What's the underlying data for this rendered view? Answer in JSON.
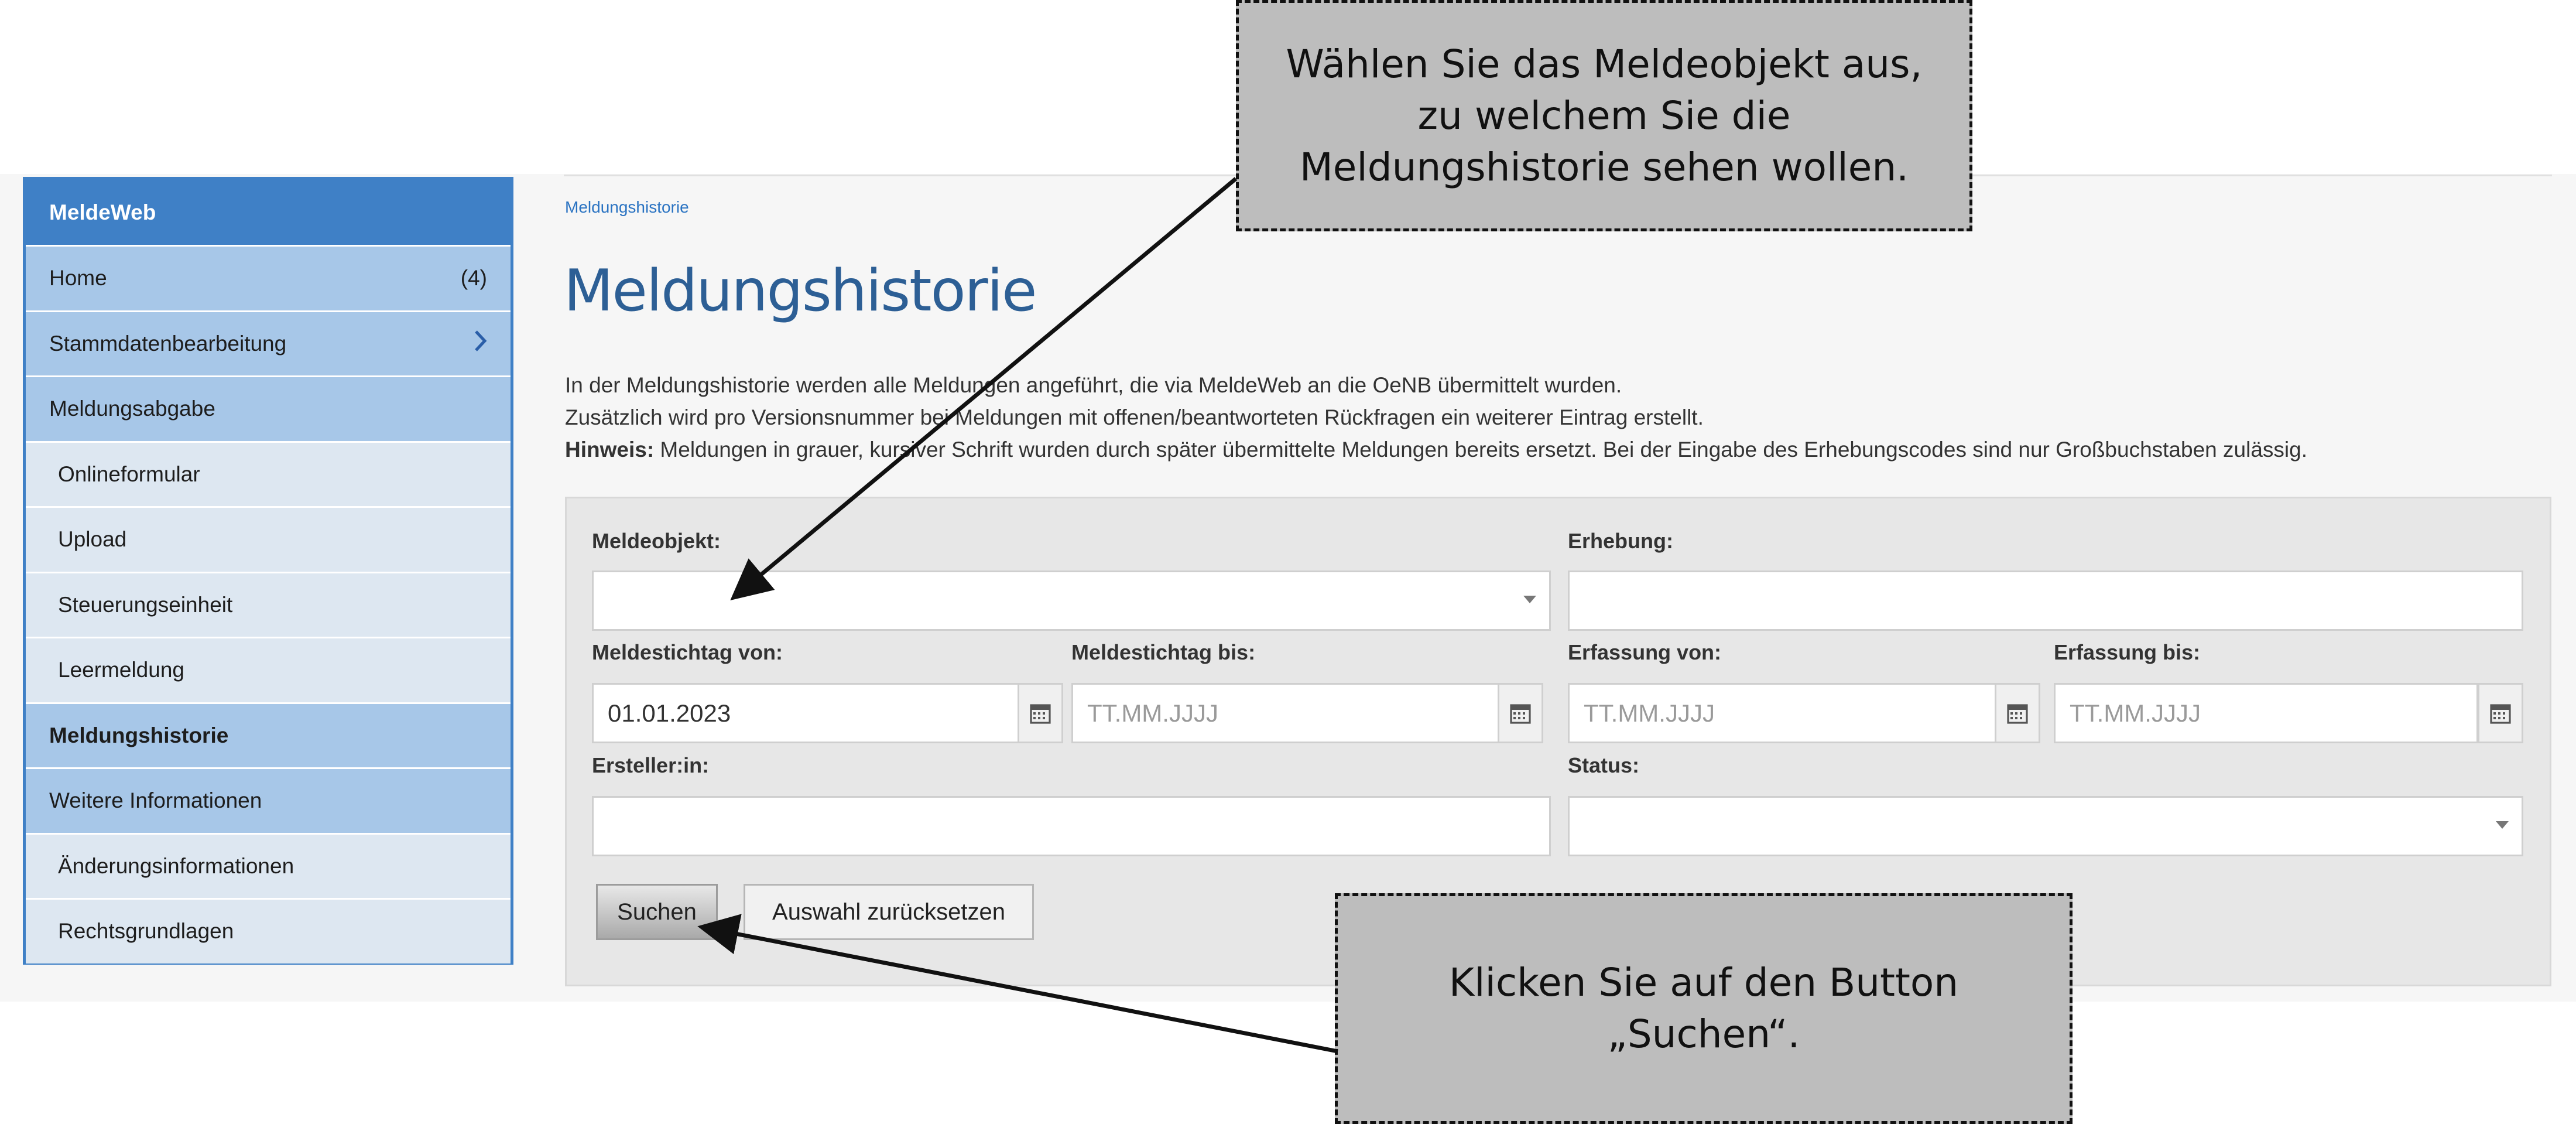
{
  "sidebar": {
    "header": "MeldeWeb",
    "items": [
      {
        "label": "Home",
        "count": "(4)"
      },
      {
        "label": "Stammdatenbearbeitung"
      },
      {
        "label": "Meldungsabgabe"
      },
      {
        "label": "Onlineformular"
      },
      {
        "label": "Upload"
      },
      {
        "label": "Steuerungseinheit"
      },
      {
        "label": "Leermeldung"
      },
      {
        "label": "Meldungshistorie"
      },
      {
        "label": "Weitere Informationen"
      },
      {
        "label": "Änderungsinformationen"
      },
      {
        "label": "Rechtsgrundlagen"
      }
    ]
  },
  "breadcrumb": "Meldungshistorie",
  "page_title": "Meldungshistorie",
  "description": {
    "line1": "In der Meldungshistorie werden alle Meldungen angeführt, die via MeldeWeb an die OeNB übermittelt wurden.",
    "line2": "Zusätzlich wird pro Versionsnummer bei Meldungen mit offenen/beantworteten Rückfragen ein weiterer Eintrag erstellt.",
    "hint_label": "Hinweis:",
    "hint_text": " Meldungen in grauer, kursiver Schrift wurden durch später übermittelte Meldungen bereits ersetzt. Bei der Eingabe des Erhebungscodes sind nur Großbuchstaben zulässig."
  },
  "form": {
    "meldeobjekt_label": "Meldeobjekt:",
    "meldeobjekt_value": "",
    "erhebung_label": "Erhebung:",
    "erhebung_value": "",
    "stichtag_von_label": "Meldestichtag von:",
    "stichtag_von_value": "01.01.2023",
    "stichtag_bis_label": "Meldestichtag bis:",
    "stichtag_bis_placeholder": "TT.MM.JJJJ",
    "erfassung_von_label": "Erfassung von:",
    "erfassung_von_placeholder": "TT.MM.JJJJ",
    "erfassung_bis_label": "Erfassung bis:",
    "erfassung_bis_placeholder": "TT.MM.JJJJ",
    "ersteller_label": "Ersteller:in:",
    "ersteller_value": "",
    "status_label": "Status:",
    "status_value": "",
    "search_button": "Suchen",
    "reset_button": "Auswahl zurücksetzen"
  },
  "callouts": {
    "top": "Wählen Sie das Meldeobjekt aus, zu welchem Sie die Meldungshistorie sehen wollen.",
    "bottom": "Klicken Sie auf den Button „Suchen“."
  },
  "colors": {
    "sidebar_header": "#3f80c6",
    "sidebar_level1": "#a7c7e8",
    "sidebar_level2": "#dde7f1",
    "title_blue": "#2d5f95",
    "callout_bg": "#bdbdbd"
  },
  "icons": {
    "chevron": "chevron-right-icon",
    "calendar": "calendar-icon",
    "dropdown": "caret-down-icon"
  }
}
